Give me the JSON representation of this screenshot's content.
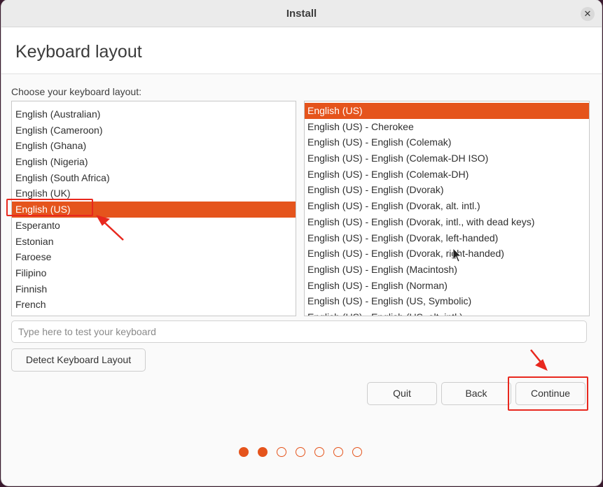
{
  "window": {
    "title": "Install"
  },
  "header": {
    "title": "Keyboard layout"
  },
  "main": {
    "choose_label": "Choose your keyboard layout:",
    "layouts": [
      {
        "label": "English (Australian)",
        "selected": false
      },
      {
        "label": "English (Cameroon)",
        "selected": false
      },
      {
        "label": "English (Ghana)",
        "selected": false
      },
      {
        "label": "English (Nigeria)",
        "selected": false
      },
      {
        "label": "English (South Africa)",
        "selected": false
      },
      {
        "label": "English (UK)",
        "selected": false
      },
      {
        "label": "English (US)",
        "selected": true
      },
      {
        "label": "Esperanto",
        "selected": false
      },
      {
        "label": "Estonian",
        "selected": false
      },
      {
        "label": "Faroese",
        "selected": false
      },
      {
        "label": "Filipino",
        "selected": false
      },
      {
        "label": "Finnish",
        "selected": false
      },
      {
        "label": "French",
        "selected": false
      }
    ],
    "variants": [
      {
        "label": "English (US)",
        "selected": true
      },
      {
        "label": "English (US) - Cherokee",
        "selected": false
      },
      {
        "label": "English (US) - English (Colemak)",
        "selected": false
      },
      {
        "label": "English (US) - English (Colemak-DH ISO)",
        "selected": false
      },
      {
        "label": "English (US) - English (Colemak-DH)",
        "selected": false
      },
      {
        "label": "English (US) - English (Dvorak)",
        "selected": false
      },
      {
        "label": "English (US) - English (Dvorak, alt. intl.)",
        "selected": false
      },
      {
        "label": "English (US) - English (Dvorak, intl., with dead keys)",
        "selected": false
      },
      {
        "label": "English (US) - English (Dvorak, left-handed)",
        "selected": false
      },
      {
        "label": "English (US) - English (Dvorak, right-handed)",
        "selected": false
      },
      {
        "label": "English (US) - English (Macintosh)",
        "selected": false
      },
      {
        "label": "English (US) - English (Norman)",
        "selected": false
      },
      {
        "label": "English (US) - English (US, Symbolic)",
        "selected": false
      },
      {
        "label": "English (US) - English (US, alt. intl.)",
        "selected": false
      }
    ],
    "test_input_placeholder": "Type here to test your keyboard",
    "detect_button": "Detect Keyboard Layout"
  },
  "footer": {
    "quit": "Quit",
    "back": "Back",
    "continue": "Continue",
    "progress": {
      "total_steps": 7,
      "completed_steps": 2
    }
  },
  "colors": {
    "accent": "#e5541c",
    "annotation": "#e8281e"
  }
}
